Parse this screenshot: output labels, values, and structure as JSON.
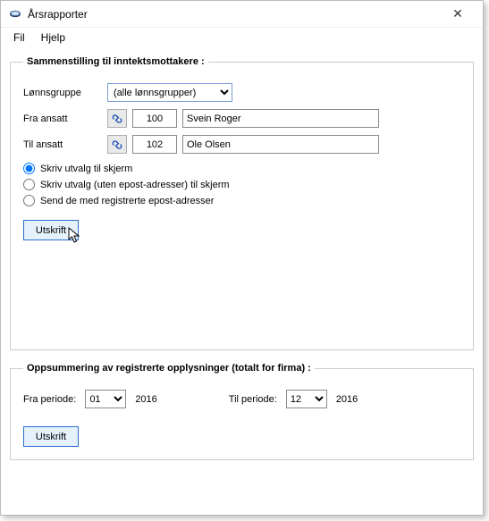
{
  "window": {
    "title": "Årsrapporter"
  },
  "menubar": {
    "file": "Fil",
    "help": "Hjelp"
  },
  "group1": {
    "legend": "Sammenstilling til inntektsmottakere :",
    "wagegroup_label": "Lønnsgruppe",
    "wagegroup_value": "(alle lønnsgrupper)",
    "from_label": "Fra ansatt",
    "from_id": "100",
    "from_name": "Svein Roger",
    "to_label": "Til ansatt",
    "to_id": "102",
    "to_name": "Ole Olsen",
    "radio1": "Skriv utvalg til skjerm",
    "radio2": "Skriv utvalg (uten epost-adresser) til skjerm",
    "radio3": "Send de med registrerte epost-adresser",
    "print": "Utskrift"
  },
  "group2": {
    "legend": "Oppsummering av registrerte opplysninger (totalt for firma) :",
    "from_label": "Fra periode:",
    "from_value": "01",
    "from_year": "2016",
    "to_label": "Til periode:",
    "to_value": "12",
    "to_year": "2016",
    "print": "Utskrift"
  }
}
